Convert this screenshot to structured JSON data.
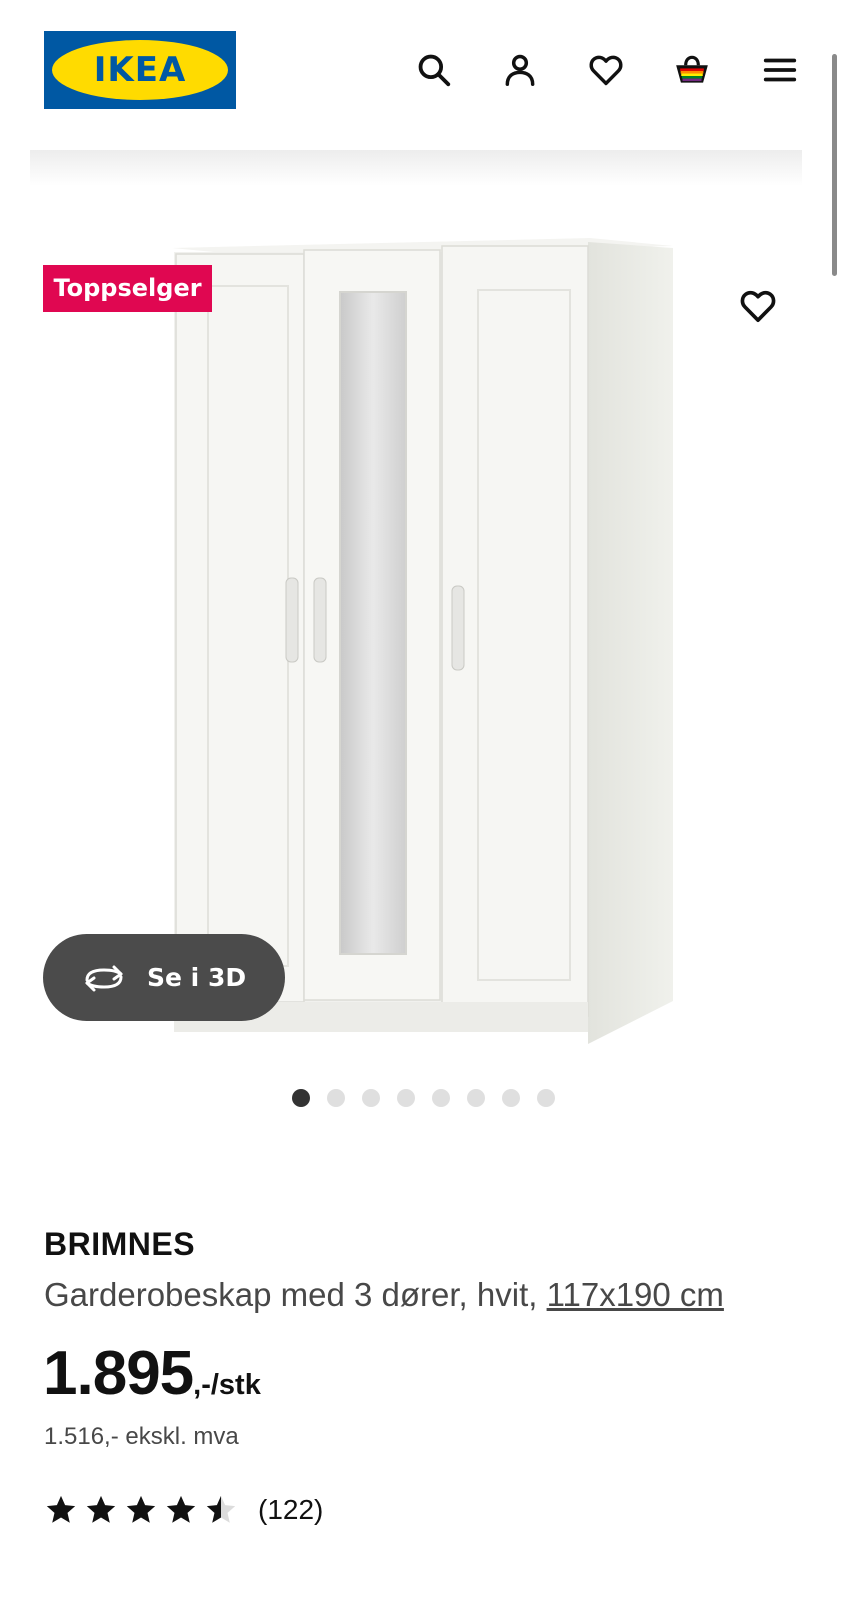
{
  "header": {
    "logo_text": "IKEA",
    "icons": [
      "search-icon",
      "account-icon",
      "heart-icon",
      "basket-icon",
      "menu-icon"
    ],
    "colors": {
      "logo_blue": "#0058a3",
      "logo_yellow": "#ffdb00"
    }
  },
  "product": {
    "badge": "Toppselger",
    "view_3d_label": "Se i 3D",
    "image_count": 8,
    "active_image": 1,
    "name": "BRIMNES",
    "description": "Garderobeskap med 3 dører, hvit, ",
    "dimensions": "117x190 cm",
    "price": "1.895",
    "price_unit": ",-/stk",
    "price_ex_vat": "1.516,- ekskl. mva",
    "rating": 4.5,
    "rating_max": 5,
    "review_count": "(122)",
    "badge_color": "#e00751"
  }
}
